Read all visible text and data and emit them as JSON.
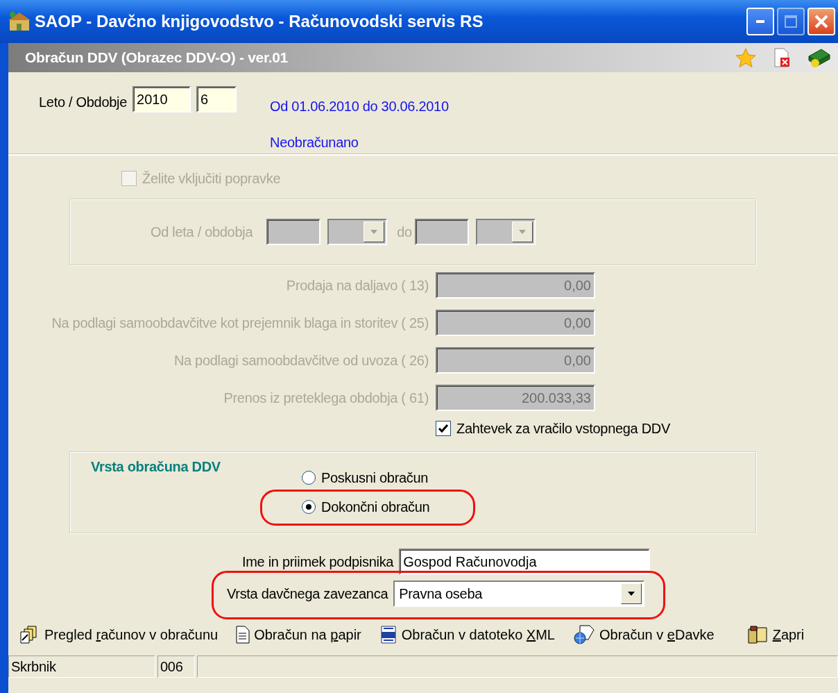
{
  "window": {
    "title": "SAOP -  Davčno knjigovodstvo - Računovodski servis RS"
  },
  "form_title": "Obračun DDV (Obrazec DDV-O)  - ver.01",
  "period": {
    "label": "Leto / Obdobje",
    "year": "2010",
    "period": "6",
    "range_text": "Od 01.06.2010 do 30.06.2010",
    "status": "Neobračunano"
  },
  "include_corrections": {
    "label": "Želite vključiti popravke",
    "checked": false,
    "disabled": true
  },
  "correction_range": {
    "label": "Od leta / obdobja",
    "separator": "do",
    "disabled": true
  },
  "amounts": [
    {
      "label": "Prodaja na  daljavo  ( 13)",
      "value": "0,00",
      "disabled": true
    },
    {
      "label": "Na podlagi samoobdavčitve kot prejemnik blaga in storitev  ( 25)",
      "value": "0,00",
      "disabled": true
    },
    {
      "label": "Na podlagi samoobdavčitve od uvoza  ( 26)",
      "value": "0,00",
      "disabled": true
    },
    {
      "label": "Prenos iz preteklega obdobja  ( 61)",
      "value": "200.033,33",
      "disabled": true
    }
  ],
  "refund_request": {
    "label": "Zahtevek za vračilo vstopnega DDV",
    "checked": true
  },
  "calculation_type": {
    "title": "Vrsta obračuna DDV",
    "options": [
      {
        "label": "Poskusni obračun",
        "selected": false
      },
      {
        "label": "Dokončni obračun",
        "selected": true,
        "highlighted": true
      }
    ]
  },
  "signer": {
    "label": "Ime in priimek podpisnika",
    "value": "Gospod Računovodja"
  },
  "taxpayer_type": {
    "label": "Vrsta davčnega zavezanca",
    "value": "Pravna oseba",
    "highlighted": true
  },
  "actions": [
    {
      "kind": "review",
      "label": {
        "before": "Pregled ",
        "key": "r",
        "after": "ačunov v obračunu"
      }
    },
    {
      "kind": "paper",
      "label": {
        "before": "Obračun na ",
        "key": "p",
        "after": "apir"
      }
    },
    {
      "kind": "xml",
      "label": {
        "before": "Obračun v datoteko ",
        "key": "X",
        "after": "ML"
      }
    },
    {
      "kind": "edavke",
      "label": {
        "before": "Obračun v ",
        "key": "e",
        "after": "Davke"
      }
    },
    {
      "kind": "close",
      "label": {
        "key": "Z",
        "after": "apri"
      }
    }
  ],
  "status_bar": [
    {
      "text": "Skrbnik"
    },
    {
      "text": "006"
    }
  ]
}
